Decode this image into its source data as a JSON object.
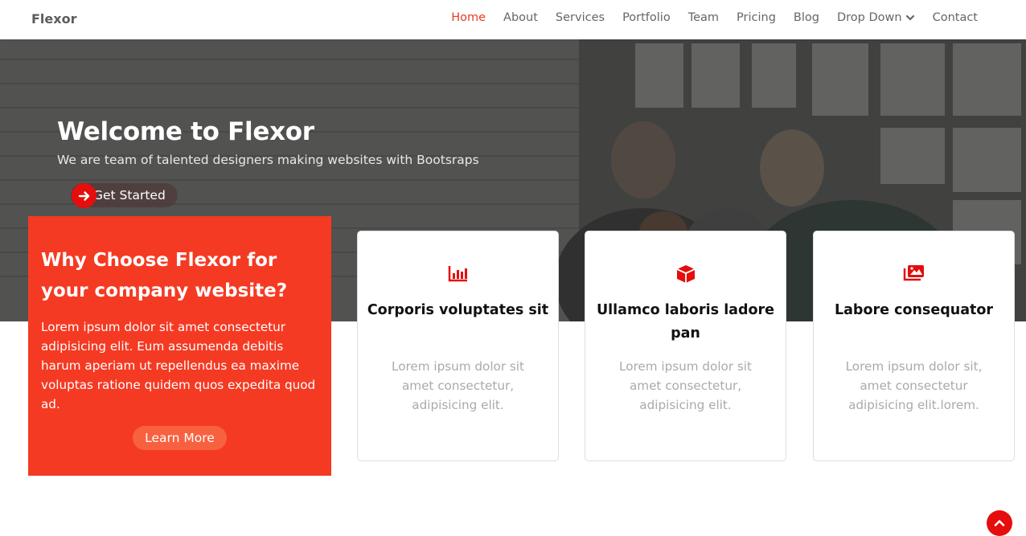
{
  "brand": {
    "name": "Flexor"
  },
  "nav": {
    "items": [
      "Home",
      "About",
      "Services",
      "Portfolio",
      "Team",
      "Pricing",
      "Blog",
      "Drop Down",
      "Contact"
    ],
    "active": "Home"
  },
  "hero": {
    "title": "Welcome to Flexor",
    "subtitle": "We are team of talented designers making websites with Bootsraps",
    "cta_label": "Get Started"
  },
  "why": {
    "title": "Why Choose Flexor for your company website?",
    "body": "Lorem ipsum dolor sit amet consectetur adipisicing elit. Eum assumenda debitis harum aperiam ut repellendus ea maxime voluptas ratione quidem quos expedita quod ad.",
    "button_label": "Learn More"
  },
  "cards": [
    {
      "icon": "bar-chart-icon",
      "title": "Corporis voluptates sit",
      "text": "Lorem ipsum dolor sit amet consectetur, adipisicing elit."
    },
    {
      "icon": "cube-icon",
      "title": "Ullamco laboris ladore pan",
      "text": "Lorem ipsum dolor sit amet consectetur, adipisicing elit."
    },
    {
      "icon": "images-icon",
      "title": "Labore consequator",
      "text": "Lorem ipsum dolor sit, amet consectetur adipisicing elit.lorem."
    }
  ],
  "colors": {
    "accent": "#e43c26",
    "why_bg": "#f53a23",
    "icon_red": "#e60d0d"
  }
}
